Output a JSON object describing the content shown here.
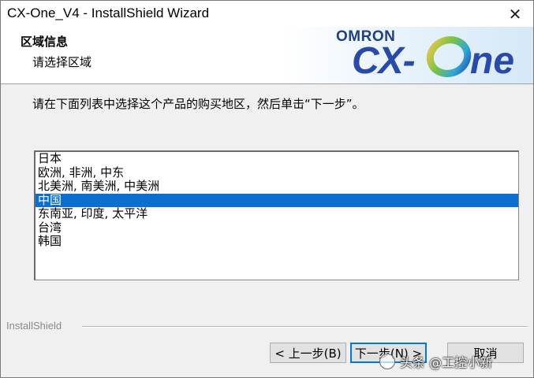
{
  "window": {
    "title": "CX-One_V4 - InstallShield Wizard",
    "close_glyph": "✕"
  },
  "header": {
    "title": "区域信息",
    "subtitle": "请选择区域",
    "logo": {
      "brand": "OMRON",
      "product_prefix": "CX-",
      "product_suffix": "ne"
    }
  },
  "instruction": "请在下面列表中选择这个产品的购买地区，然后单击“下一步”。",
  "regions": [
    {
      "label": "日本",
      "selected": false
    },
    {
      "label": "欧洲, 非洲, 中东",
      "selected": false
    },
    {
      "label": "北美洲, 南美洲, 中美洲",
      "selected": false
    },
    {
      "label": "中国",
      "selected": true
    },
    {
      "label": "东南亚, 印度, 太平洋",
      "selected": false
    },
    {
      "label": "台湾",
      "selected": false
    },
    {
      "label": "韩国",
      "selected": false
    }
  ],
  "footer": {
    "brand": "InstallShield",
    "back_label": "< 上一步(B)",
    "next_label": "下一步(N) >",
    "cancel_label": "取消"
  },
  "watermark": "头条 @工控小新",
  "colors": {
    "selection": "#0a6fd1",
    "logo_blue": "#2a4aa8",
    "default_button_border": "#0078d7"
  }
}
